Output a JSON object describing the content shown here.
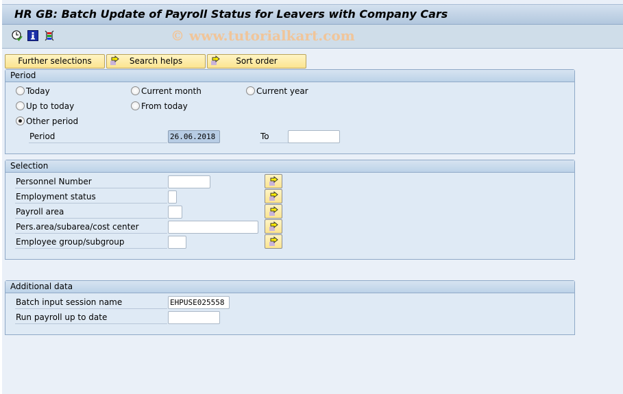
{
  "window": {
    "title": "HR GB: Batch Update of Payroll Status for Leavers with Company Cars",
    "watermark": "© www.tutorialkart.com"
  },
  "toolbar": {
    "icons": [
      "execute-clock-icon",
      "info-icon",
      "selection-options-icon"
    ]
  },
  "buttons": {
    "further_selections": "Further selections",
    "search_helps": "Search helps",
    "sort_order": "Sort order"
  },
  "period": {
    "header": "Period",
    "radios": {
      "today": "Today",
      "current_month": "Current month",
      "current_year": "Current year",
      "up_to_today": "Up to today",
      "from_today": "From today",
      "other_period": "Other period"
    },
    "selected": "other_period",
    "period_label": "Period",
    "period_from": "26.06.2018",
    "to_label": "To",
    "period_to": ""
  },
  "selection": {
    "header": "Selection",
    "rows": [
      {
        "label": "Personnel Number",
        "value": ""
      },
      {
        "label": "Employment status",
        "value": ""
      },
      {
        "label": "Payroll area",
        "value": ""
      },
      {
        "label": "Pers.area/subarea/cost center",
        "value": ""
      },
      {
        "label": "Employee group/subgroup",
        "value": ""
      }
    ]
  },
  "additional": {
    "header": "Additional data",
    "rows": [
      {
        "label": "Batch input session name",
        "value": "EHPUSE025558"
      },
      {
        "label": "Run payroll up to date",
        "value": ""
      }
    ]
  },
  "colors": {
    "button_yellow": "#fbe48f",
    "group_header": "#bcd2e8",
    "background": "#eaf0f8"
  }
}
